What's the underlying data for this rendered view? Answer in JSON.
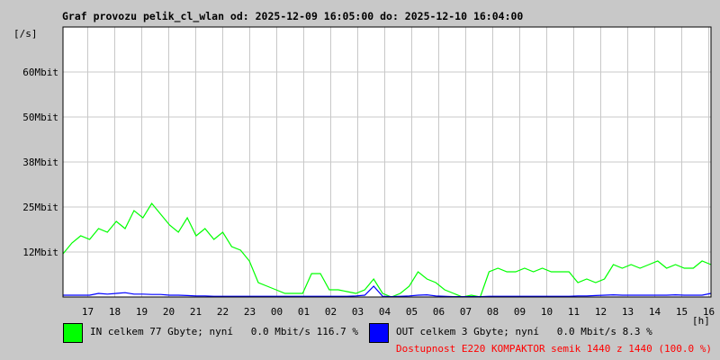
{
  "chart_data": {
    "type": "line",
    "title": "Graf provozu pelik_cl_wlan od: 2025-12-09 16:05:00 do: 2025-12-10 16:04:00",
    "ylabel": "[/s]",
    "xlabel": "[h]",
    "ylim": [
      0,
      75
    ],
    "yticks": [
      {
        "v": 12.5,
        "label": "12Mbit"
      },
      {
        "v": 25,
        "label": "25Mbit"
      },
      {
        "v": 37.5,
        "label": "38Mbit"
      },
      {
        "v": 50,
        "label": "50Mbit"
      },
      {
        "v": 62.5,
        "label": "60Mbit"
      }
    ],
    "xticks": [
      "17",
      "18",
      "19",
      "20",
      "21",
      "22",
      "23",
      "00",
      "01",
      "02",
      "03",
      "04",
      "05",
      "06",
      "07",
      "08",
      "09",
      "10",
      "11",
      "12",
      "13",
      "14",
      "15",
      "16"
    ],
    "x_hours_from_start": "0..24 step 0.5",
    "series": [
      {
        "name": "IN",
        "color": "#00ff00",
        "values": [
          12,
          15,
          17,
          16,
          19,
          18,
          21,
          19,
          24,
          22,
          26,
          23,
          20,
          18,
          22,
          17,
          19,
          16,
          18,
          14,
          13,
          10,
          4,
          3,
          2,
          1,
          1,
          1,
          6.5,
          6.5,
          2,
          2,
          1.5,
          1,
          2,
          5,
          1,
          0,
          1,
          3,
          7,
          5,
          4,
          2,
          1,
          0,
          0.5,
          0,
          7,
          8,
          7,
          7,
          8,
          7,
          8,
          7,
          7,
          7,
          4,
          5,
          4,
          5,
          9,
          8,
          9,
          8,
          9,
          10,
          8,
          9,
          8,
          8,
          10,
          9
        ]
      },
      {
        "name": "OUT",
        "color": "#0000ff",
        "values": [
          0.5,
          0.5,
          0.5,
          0.5,
          1,
          0.8,
          1,
          1.2,
          0.8,
          0.8,
          0.7,
          0.7,
          0.5,
          0.5,
          0.4,
          0.3,
          0.3,
          0.2,
          0.2,
          0.2,
          0.2,
          0.2,
          0.2,
          0.2,
          0.2,
          0.2,
          0.2,
          0.2,
          0.2,
          0.2,
          0.2,
          0.2,
          0.2,
          0.3,
          0.5,
          3,
          0.2,
          0.1,
          0.2,
          0.3,
          0.5,
          0.6,
          0.3,
          0.2,
          0.1,
          0.1,
          0.1,
          0.1,
          0.2,
          0.2,
          0.2,
          0.2,
          0.2,
          0.2,
          0.2,
          0.2,
          0.2,
          0.2,
          0.3,
          0.3,
          0.4,
          0.5,
          0.6,
          0.5,
          0.5,
          0.5,
          0.5,
          0.5,
          0.5,
          0.6,
          0.5,
          0.5,
          0.5,
          1
        ]
      }
    ]
  },
  "legend": {
    "in_text": "IN celkem 77 Gbyte; nyní   0.0 Mbit/s 116.7 %",
    "out_text": "OUT celkem 3 Gbyte; nyní   0.0 Mbit/s 8.3 %",
    "availability": "Dostupnost E220 KOMPAKTOR semik 1440 z 1440 (100.0 %)",
    "in_color": "#00ff00",
    "out_color": "#0000ff",
    "avail_color": "#ff0000"
  }
}
